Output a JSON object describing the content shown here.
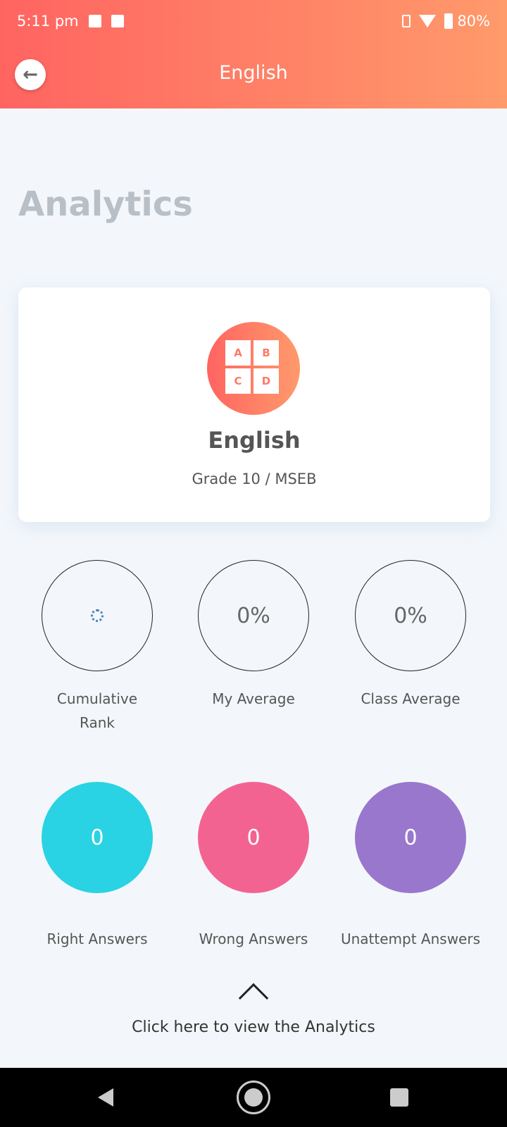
{
  "status_bar": {
    "time": "5:11 pm",
    "battery": "80%",
    "icons": [
      "gallery-icon",
      "facebook-icon",
      "vibrate-icon",
      "wifi-icon",
      "battery-icon"
    ]
  },
  "header": {
    "title": "English",
    "back_icon": "arrow-left-icon"
  },
  "page_title": "Analytics",
  "course_card": {
    "logo_letters": [
      "A",
      "B",
      "C",
      "D"
    ],
    "name": "English",
    "grade": "Grade 10 / MSEB"
  },
  "stats": [
    {
      "label_line1": "Cumulative",
      "label_line2": "Rank",
      "value": "",
      "loading": true
    },
    {
      "label_line1": "My Average",
      "value": "0%"
    },
    {
      "label_line1": "Class Average",
      "value": "0%"
    }
  ],
  "answers": [
    {
      "label": "Right Answers",
      "value": "0",
      "color": "#29d3e3"
    },
    {
      "label": "Wrong Answers",
      "value": "0",
      "color": "#f36391"
    },
    {
      "label": "Unattempt Answers",
      "value": "0",
      "color": "#9877cc"
    }
  ],
  "cta": "Click here to view the Analytics",
  "colors": {
    "header_start": "#ff6461",
    "header_end": "#ff9a6b"
  }
}
